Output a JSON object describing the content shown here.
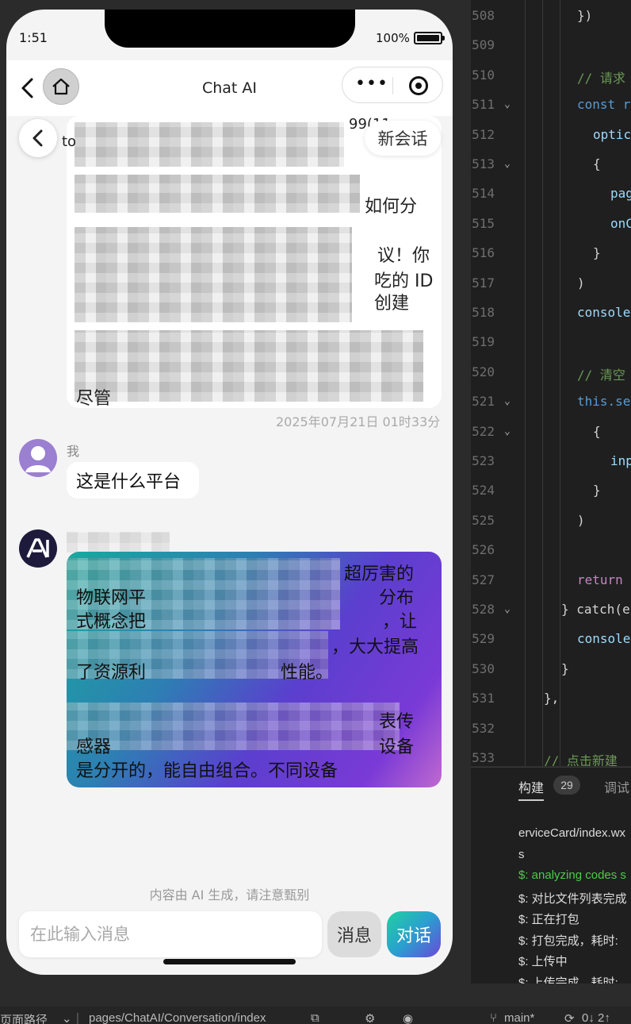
{
  "status_bar": {
    "time": "1:51",
    "battery": "100%"
  },
  "navbar": {
    "title": "Chat AI",
    "more_glyph": "•••"
  },
  "header_actions": {
    "new_chat": "新会话"
  },
  "chat": {
    "prev_ai_fragments": [
      "99(11",
      "to",
      "如何分",
      "议！你",
      "吃的 ID",
      "创建",
      "尽管"
    ],
    "prev_timestamp": "2025年07月21日 01时33分",
    "user_label": "我",
    "user_message": "这是什么平台",
    "ai_lines": [
      "超厉害的",
      "物联网平",
      "分布",
      "式概念把",
      "，让",
      "，大大提高",
      "了资源利",
      "性能。",
      "表传",
      "感器",
      "设备",
      "是分开的，能自由组合。不同设备"
    ]
  },
  "footer": {
    "disclaimer": "内容由 AI 生成，请注意甄别",
    "input_placeholder": "在此输入消息",
    "message_button": "消息",
    "chat_button": "对话"
  },
  "editor": {
    "lines": [
      {
        "n": "508",
        "text": "})",
        "color": "#d4d4d4",
        "indent": 134
      },
      {
        "n": "509",
        "text": "",
        "color": "#d4d4d4",
        "indent": 134
      },
      {
        "n": "510",
        "text": "// 请求",
        "color": "#6a9955",
        "indent": 134
      },
      {
        "n": "511",
        "text": "const r",
        "color": "#569cd6",
        "indent": 134
      },
      {
        "n": "512",
        "text": "optic",
        "color": "#9cdcfe",
        "indent": 154
      },
      {
        "n": "513",
        "text": "{",
        "color": "#d4d4d4",
        "indent": 154
      },
      {
        "n": "514",
        "text": "pag",
        "color": "#9cdcfe",
        "indent": 176
      },
      {
        "n": "515",
        "text": "onC",
        "color": "#9cdcfe",
        "indent": 176
      },
      {
        "n": "516",
        "text": "}",
        "color": "#d4d4d4",
        "indent": 154
      },
      {
        "n": "517",
        "text": ")",
        "color": "#d4d4d4",
        "indent": 134
      },
      {
        "n": "518",
        "text": "console",
        "color": "#9cdcfe",
        "indent": 134
      },
      {
        "n": "519",
        "text": "",
        "color": "#d4d4d4",
        "indent": 134
      },
      {
        "n": "520",
        "text": "// 清空",
        "color": "#6a9955",
        "indent": 134
      },
      {
        "n": "521",
        "text": "this.se",
        "color": "#569cd6",
        "indent": 134
      },
      {
        "n": "522",
        "text": "{",
        "color": "#d4d4d4",
        "indent": 154
      },
      {
        "n": "523",
        "text": "inp",
        "color": "#9cdcfe",
        "indent": 176
      },
      {
        "n": "524",
        "text": "}",
        "color": "#d4d4d4",
        "indent": 154
      },
      {
        "n": "525",
        "text": ")",
        "color": "#d4d4d4",
        "indent": 134
      },
      {
        "n": "526",
        "text": "",
        "color": "#d4d4d4",
        "indent": 134
      },
      {
        "n": "527",
        "text": "return",
        "color": "#c586c0",
        "indent": 134
      },
      {
        "n": "528",
        "text": "} catch(e",
        "color": "#d4d4d4",
        "indent": 114
      },
      {
        "n": "529",
        "text": "console",
        "color": "#9cdcfe",
        "indent": 134
      },
      {
        "n": "530",
        "text": "}",
        "color": "#d4d4d4",
        "indent": 114
      },
      {
        "n": "531",
        "text": "},",
        "color": "#d4d4d4",
        "indent": 92
      },
      {
        "n": "532",
        "text": "",
        "color": "#d4d4d4",
        "indent": 92
      },
      {
        "n": "533",
        "text": "// 点击新建",
        "color": "#6a9955",
        "indent": 92
      }
    ],
    "fold_lines": [
      "511",
      "513",
      "521",
      "522",
      "528"
    ]
  },
  "panel": {
    "tab_build": "构建",
    "tab_build_count": "29",
    "tab_debug": "调试",
    "logs": [
      {
        "text": "erviceCard/index.wx",
        "color": "#dddddd"
      },
      {
        "text": "s",
        "color": "#dddddd"
      },
      {
        "text": "$: analyzing codes s",
        "color": "#4ec94e"
      },
      {
        "text": "$: 对比文件列表完成",
        "color": "#dddddd"
      },
      {
        "text": "$: 正在打包",
        "color": "#dddddd"
      },
      {
        "text": "$: 打包完成，耗时:",
        "color": "#dddddd"
      },
      {
        "text": "$: 上传中",
        "color": "#dddddd"
      },
      {
        "text": "$: 上传完成，耗时:",
        "color": "#dddddd"
      }
    ]
  },
  "bottom_bar": {
    "page_path_label": "页面路径",
    "page_path": "pages/ChatAI/Conversation/index",
    "branch": "main*",
    "sync": "0↓ 2↑"
  }
}
